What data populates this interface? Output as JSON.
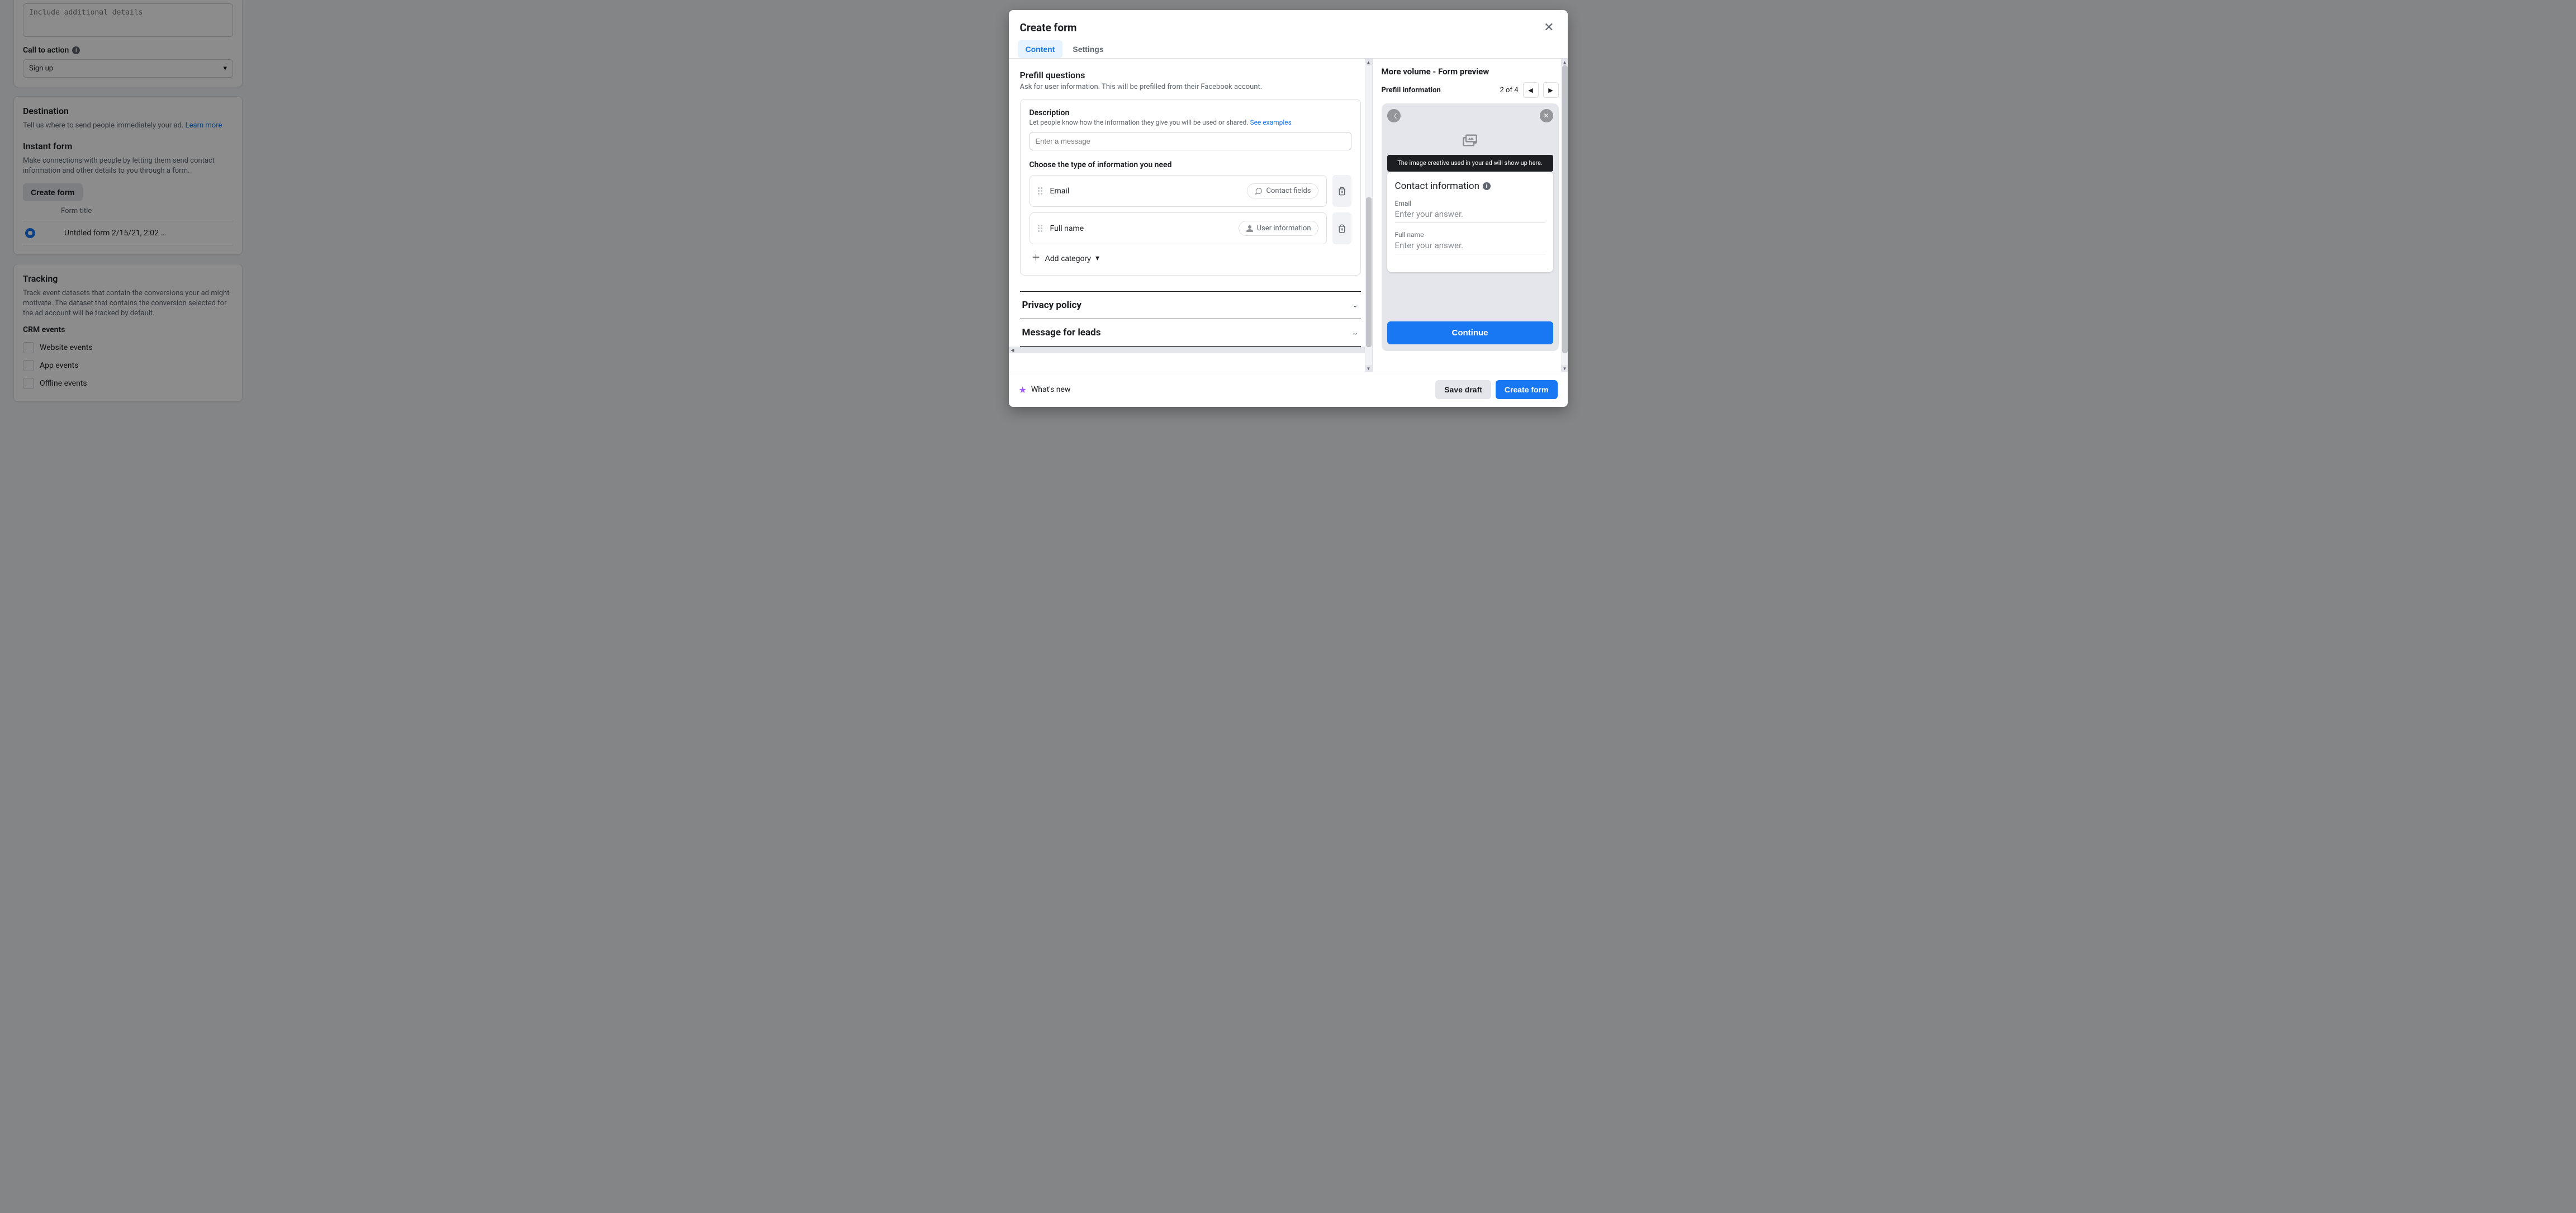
{
  "bg": {
    "additional_details_placeholder": "Include additional details",
    "cta_label": "Call to action",
    "cta_value": "Sign up",
    "destination_heading": "Destination",
    "destination_text_prefix": "Tell us where to send people immediately your ad. ",
    "destination_learn_more": "Learn more",
    "instant_form_heading": "Instant form",
    "instant_form_text": "Make connections with people by letting them send contact information and other details to you through a form.",
    "create_form_btn": "Create form",
    "form_title_header": "Form title",
    "form_row_title": "Untitled form 2/15/21, 2:02 …",
    "tracking_heading": "Tracking",
    "tracking_text": "Track event datasets that contain the conversions your ad might motivate. The dataset that contains the conversion selected for the ad account will be tracked by default.",
    "crm_heading": "CRM events",
    "crm_options": [
      "Website events",
      "App events",
      "Offline events"
    ]
  },
  "modal": {
    "title": "Create form",
    "tabs": {
      "content": "Content",
      "settings": "Settings"
    },
    "prefill": {
      "heading": "Prefill questions",
      "sub": "Ask for user information. This will be prefilled from their Facebook account.",
      "desc_label": "Description",
      "desc_help": "Let people know how the information they give you will be used or shared. ",
      "desc_link": "See examples",
      "desc_placeholder": "Enter a message",
      "choose_label": "Choose the type of information you need",
      "fields": [
        {
          "label": "Email",
          "tag": "Contact fields"
        },
        {
          "label": "Full name",
          "tag": "User information"
        }
      ],
      "add_category": "Add category"
    },
    "accordion": {
      "privacy": "Privacy policy",
      "message": "Message for leads"
    },
    "footer": {
      "whats_new": "What's new",
      "save_draft": "Save draft",
      "create_form": "Create form"
    }
  },
  "preview": {
    "title": "More volume - Form preview",
    "section": "Prefill information",
    "step": "2 of 4",
    "tooltip": "The image creative used in your ad will show up here.",
    "card_title": "Contact information",
    "fields": [
      {
        "label": "Email",
        "placeholder": "Enter your answer."
      },
      {
        "label": "Full name",
        "placeholder": "Enter your answer."
      }
    ],
    "continue": "Continue"
  }
}
